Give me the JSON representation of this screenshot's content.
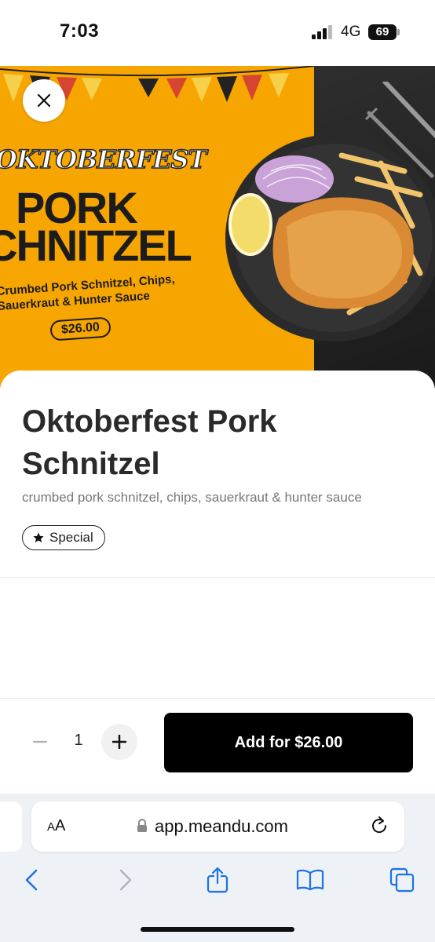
{
  "status_bar": {
    "time": "7:03",
    "network": "4G",
    "battery": "69"
  },
  "hero": {
    "subtitle": "OKTOBERFEST",
    "title_line1": "PORK",
    "title_line2": "CHNITZEL",
    "description": "Crumbed Pork Schnitzel, Chips, Sauerkraut & Hunter Sauce",
    "price": "$26.00"
  },
  "item": {
    "title": "Oktoberfest Pork Schnitzel",
    "description": "crumbed pork schnitzel, chips, sauerkraut & hunter sauce",
    "badge": "Special"
  },
  "order": {
    "quantity": "1",
    "add_label": "Add for $26.00"
  },
  "browser": {
    "text_size_label": "AA",
    "url": "app.meandu.com"
  },
  "colors": {
    "banner": "#f7a500",
    "button": "#000000"
  }
}
